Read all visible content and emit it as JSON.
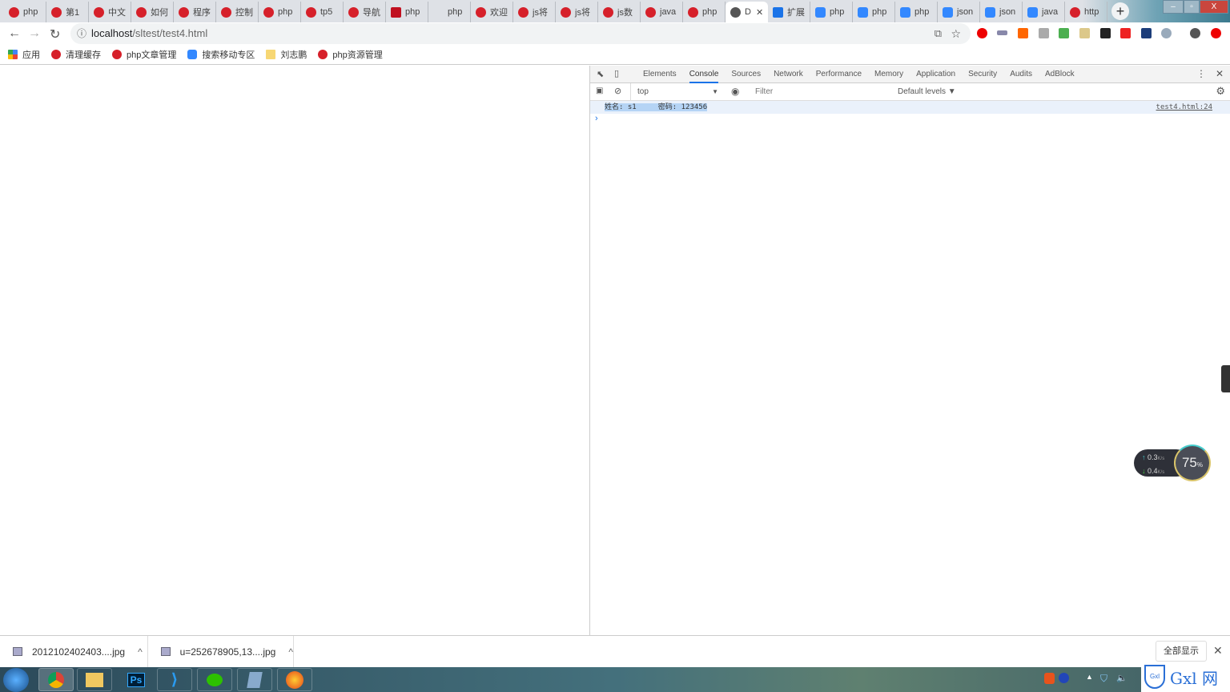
{
  "tabs": [
    {
      "label": "php",
      "icon": "php"
    },
    {
      "label": "第1",
      "icon": "php"
    },
    {
      "label": "中文",
      "icon": "php"
    },
    {
      "label": "如何",
      "icon": "php"
    },
    {
      "label": "程序",
      "icon": "php"
    },
    {
      "label": "控制",
      "icon": "php"
    },
    {
      "label": "php",
      "icon": "php"
    },
    {
      "label": "tp5",
      "icon": "php"
    },
    {
      "label": "导航",
      "icon": "php"
    },
    {
      "label": "php",
      "icon": "c"
    },
    {
      "label": "php",
      "icon": "script"
    },
    {
      "label": "欢迎",
      "icon": "php"
    },
    {
      "label": "js将",
      "icon": "php"
    },
    {
      "label": "js将",
      "icon": "php"
    },
    {
      "label": "js数",
      "icon": "php"
    },
    {
      "label": "java",
      "icon": "php"
    },
    {
      "label": "php",
      "icon": "php"
    },
    {
      "label": "D",
      "icon": "globe",
      "active": true
    },
    {
      "label": "扩展",
      "icon": "puzzle"
    },
    {
      "label": "php",
      "icon": "paw"
    },
    {
      "label": "php",
      "icon": "paw"
    },
    {
      "label": "php",
      "icon": "paw"
    },
    {
      "label": "json",
      "icon": "paw"
    },
    {
      "label": "json",
      "icon": "paw"
    },
    {
      "label": "java",
      "icon": "paw"
    },
    {
      "label": "http",
      "icon": "php"
    }
  ],
  "new_tab": "+",
  "window": {
    "minimize": "–",
    "restore": "▫",
    "close": "X"
  },
  "address": {
    "host": "localhost",
    "path": "/sltest/test4.html"
  },
  "bookmarks": [
    {
      "label": "应用",
      "icon": "apps"
    },
    {
      "label": "清理缓存",
      "icon": "php"
    },
    {
      "label": "php文章管理",
      "icon": "php"
    },
    {
      "label": "搜索移动专区",
      "icon": "paw"
    },
    {
      "label": "刘志鹏",
      "icon": "folder"
    },
    {
      "label": "php资源管理",
      "icon": "php"
    }
  ],
  "devtools": {
    "tabs": [
      "Elements",
      "Console",
      "Sources",
      "Network",
      "Performance",
      "Memory",
      "Application",
      "Security",
      "Audits",
      "AdBlock"
    ],
    "active_tab": "Console",
    "context": "top",
    "filter_placeholder": "Filter",
    "levels": "Default levels ▼",
    "log": {
      "text1": "姓名: s1",
      "text2": "密码: 123456",
      "source": "test4.html:24"
    },
    "prompt": "›"
  },
  "speed_widget": {
    "up": "0.3",
    "down": "0.4",
    "unit": "K/s",
    "percent": "75",
    "percent_sign": "%"
  },
  "downloads": {
    "items": [
      "2012102402403....jpg",
      "u=252678905,13....jpg"
    ],
    "show_all": "全部显示",
    "close": "✕"
  },
  "taskbar": {
    "apps": [
      "start",
      "chrome",
      "explorer",
      "Ps",
      "vscode",
      "wechat",
      "notepad",
      "firefox"
    ]
  },
  "watermark": {
    "text": "Gxl 网",
    "url": "www.gxlsystem.com"
  },
  "colors": {
    "accent": "#1a73e8",
    "php_red": "#d6202a"
  }
}
